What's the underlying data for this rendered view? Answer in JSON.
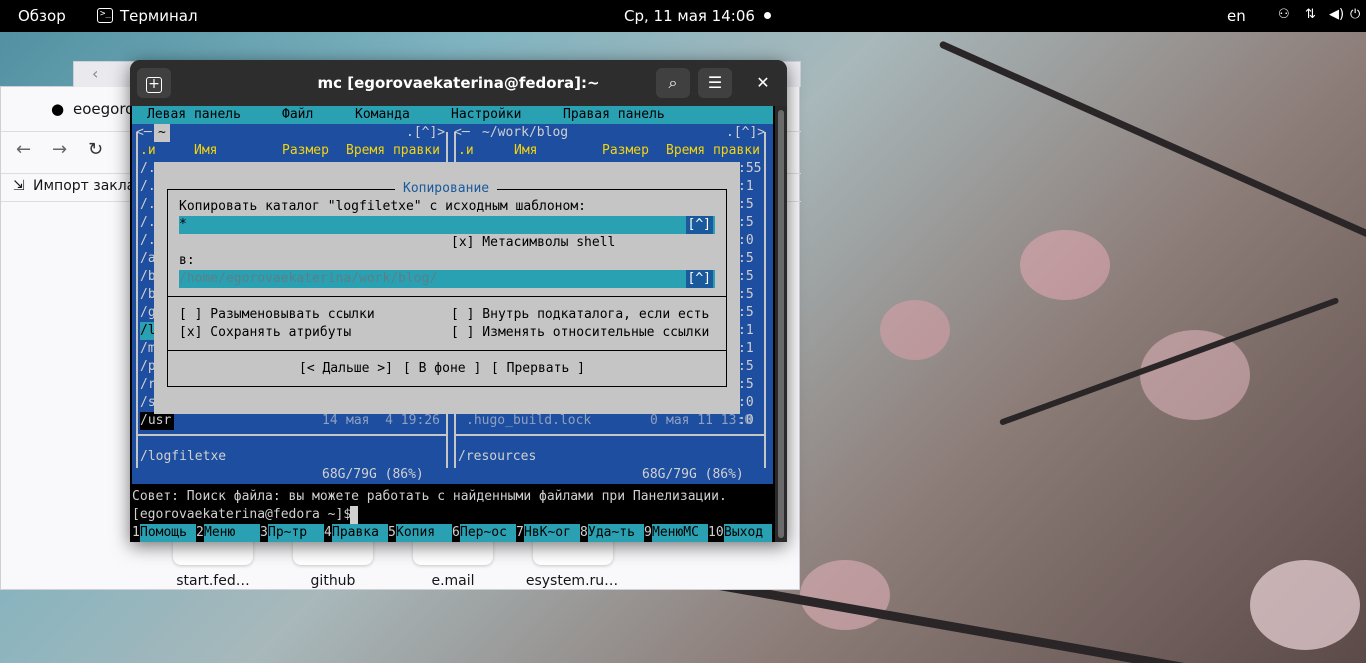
{
  "topbar": {
    "overview": "Обзор",
    "app_name": "Терминал",
    "datetime": "Ср, 11 мая  14:06",
    "lang": "en"
  },
  "browser": {
    "tab_title": "eoegorov",
    "import_bookmarks": "Импорт заклад",
    "shortcuts": [
      "start.fed…",
      "github",
      "e.mail",
      "esystem.ru…"
    ]
  },
  "terminal": {
    "title": "mc [egorovaekaterina@fedora]:~",
    "menu": [
      "Левая панель",
      "Файл",
      "Команда",
      "Настройки",
      "Правая панель"
    ],
    "left_panel": {
      "path": "~",
      "corner": ".[^]>",
      "headers": [
        ".и",
        "Имя",
        "Размер",
        "Время правки"
      ],
      "rows": [
        "/.",
        "/.",
        "/.",
        "/.",
        "/.",
        "/a",
        "/b",
        "/b",
        "/g",
        "/l",
        "/m",
        "/p",
        "/r",
        "/s"
      ],
      "last_row": {
        "name": "/usr",
        "size": "14",
        "date": "мая  4 19:26"
      },
      "status": "/logfiletxe",
      "disk": "68G/79G (86%)"
    },
    "right_panel": {
      "path": "~/work/blog",
      "corner": ".[^]>",
      "headers": [
        ".и",
        "Имя",
        "Размер",
        "Время правки"
      ],
      "times": [
        ":55",
        ":1",
        ":5",
        ":5",
        ":0",
        ":5",
        ":5",
        ":5",
        ":5",
        ":1",
        ":1",
        ":5",
        ":5",
        ":0",
        ":0"
      ],
      "last_row": {
        "name": ".hugo_build.lock",
        "size": "0",
        "date": "мая 11 13:0"
      },
      "status": "/resources",
      "disk": "68G/79G (86%)"
    },
    "dialog": {
      "title": "Копирование",
      "prompt": "Копировать каталог \"logfiletxe\" с исходным шаблоном:",
      "source_value": "*",
      "history_btn": "[^]",
      "shell_option": "[x] Метасимволы shell",
      "to_label": "в:",
      "dest_value": "/home/egorovaekaterina/work/blog/",
      "opt_deref": "[ ] Разыменовывать ссылки",
      "opt_inside": "[ ] Внутрь подкаталога, если есть",
      "opt_keep_attrs": "[x] Сохранять атрибуты",
      "opt_rel_links": "[ ] Изменять относительные ссылки",
      "btn_next": "[< Дальше >]",
      "btn_background": "[ В фоне ]",
      "btn_abort": "[ Прервать ]"
    },
    "hint": "Совет: Поиск файла: вы можете работать с найденными файлами при Панелизации.",
    "prompt": "[egorovaekaterina@fedora ~]$",
    "fkeys": [
      {
        "n": "1",
        "label": "Помощь"
      },
      {
        "n": "2",
        "label": "Меню  "
      },
      {
        "n": "3",
        "label": "Пр~тр"
      },
      {
        "n": "4",
        "label": "Правка"
      },
      {
        "n": "5",
        "label": "Копия "
      },
      {
        "n": "6",
        "label": "Пер~ос"
      },
      {
        "n": "7",
        "label": "НвК~ог"
      },
      {
        "n": "8",
        "label": "Уда~ть"
      },
      {
        "n": "9",
        "label": "МенюMC"
      },
      {
        "n": "10",
        "label": "Выход"
      }
    ]
  }
}
